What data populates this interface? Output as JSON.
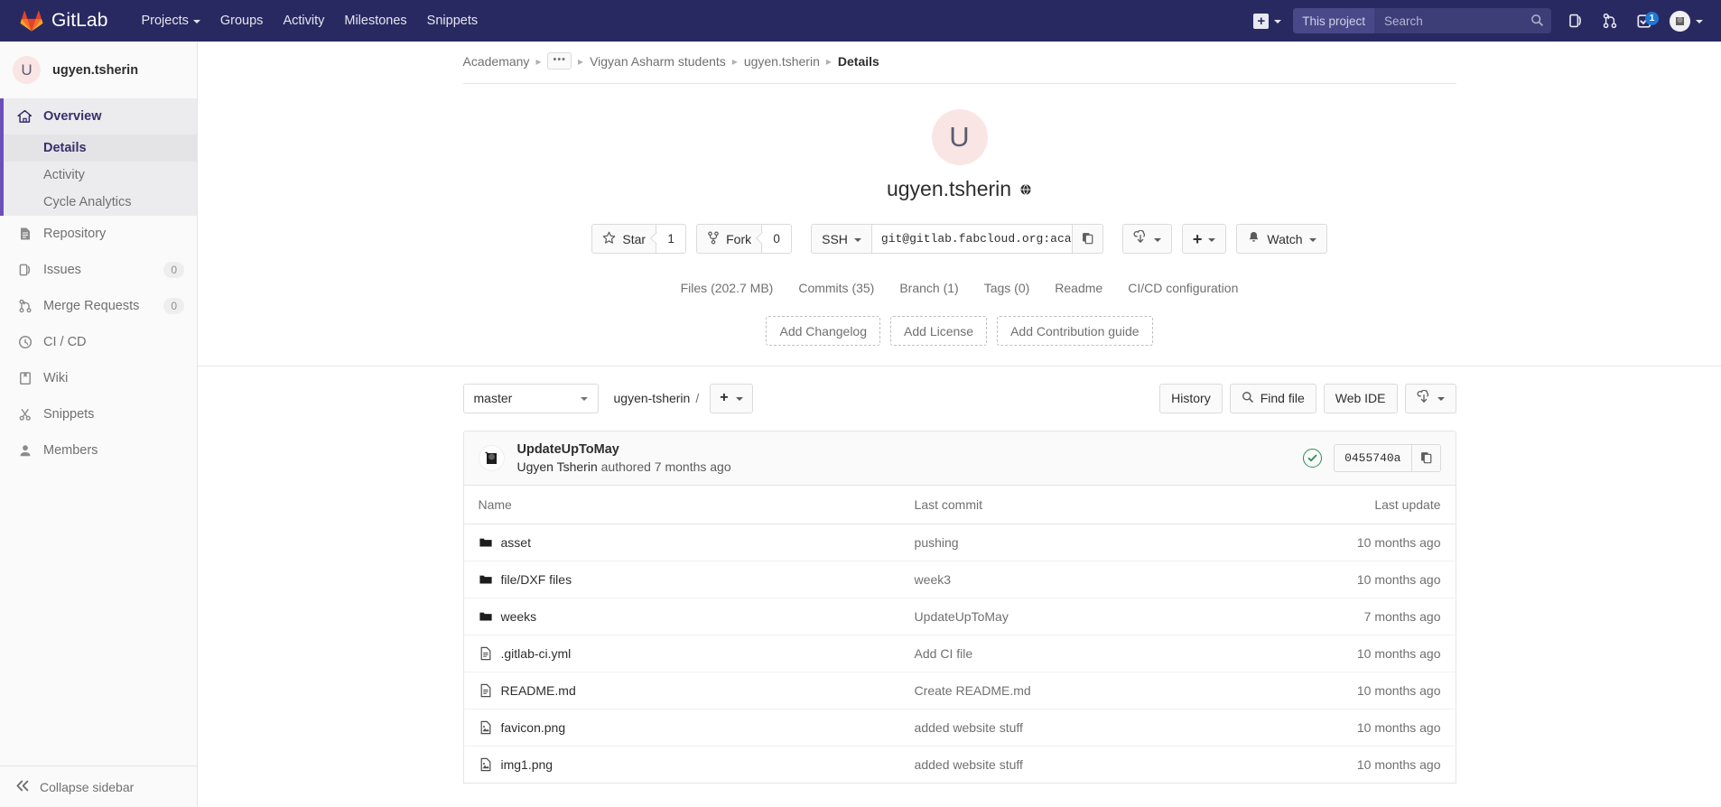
{
  "navbar": {
    "brand": "GitLab",
    "brand_icon": "gitlab-tanuki-logo",
    "links": [
      {
        "label": "Projects",
        "has_caret": true
      },
      {
        "label": "Groups",
        "has_caret": false
      },
      {
        "label": "Activity",
        "has_caret": false
      },
      {
        "label": "Milestones",
        "has_caret": false
      },
      {
        "label": "Snippets",
        "has_caret": false
      }
    ],
    "new_button": {
      "icon": "plus-square-icon",
      "label": "+",
      "caret": true
    },
    "search": {
      "scope_label": "This project",
      "placeholder": "Search",
      "value": "",
      "icon": "search-icon"
    },
    "icons": [
      {
        "name": "issues-icon",
        "title": "Issues"
      },
      {
        "name": "merge-requests-icon",
        "title": "Merge requests"
      },
      {
        "name": "todos-icon",
        "title": "Todos",
        "badge": "1"
      }
    ],
    "avatar": {
      "name": "user-avatar",
      "caret": true
    },
    "colors": {
      "bg": "#292961",
      "search_bg": "#3d3d78",
      "badge": "#1f78d1"
    }
  },
  "sidebar": {
    "project": {
      "initial": "U",
      "name": "ugyen.tsherin"
    },
    "groups": [
      {
        "label": "Overview",
        "icon": "home-icon",
        "active": true,
        "sub_items": [
          {
            "label": "Details",
            "current": true
          },
          {
            "label": "Activity",
            "current": false
          },
          {
            "label": "Cycle Analytics",
            "current": false
          }
        ]
      },
      {
        "label": "Repository",
        "icon": "doc-text-icon",
        "active": false,
        "sub_items": []
      },
      {
        "label": "Issues",
        "icon": "issues-icon",
        "count": "0",
        "active": false,
        "sub_items": []
      },
      {
        "label": "Merge Requests",
        "icon": "merge-requests-icon",
        "count": "0",
        "active": false,
        "sub_items": []
      },
      {
        "label": "CI / CD",
        "icon": "rocket-icon",
        "active": false,
        "sub_items": []
      },
      {
        "label": "Wiki",
        "icon": "book-icon",
        "active": false,
        "sub_items": []
      },
      {
        "label": "Snippets",
        "icon": "scissors-icon",
        "active": false,
        "sub_items": []
      },
      {
        "label": "Members",
        "icon": "users-icon",
        "active": false,
        "sub_items": []
      }
    ],
    "collapse": {
      "label": "Collapse sidebar",
      "icon": "chevron-double-left-icon"
    },
    "colors": {
      "bg": "#fafafa",
      "active_border": "#6b4fbb",
      "active_bg": "#ececef"
    }
  },
  "breadcrumb": {
    "items": [
      {
        "label": "Academany",
        "type": "link"
      },
      {
        "label": "•••",
        "type": "ellipsis"
      },
      {
        "label": "Vigyan Asharm students",
        "type": "link"
      },
      {
        "label": "ugyen.tsherin",
        "type": "link"
      },
      {
        "label": "Details",
        "type": "current"
      }
    ]
  },
  "project_home": {
    "avatar_initial": "U",
    "title": "ugyen.tsherin",
    "visibility_icon": "globe-public-icon",
    "actions": {
      "star": {
        "label": "Star",
        "icon": "star-icon",
        "count": "1"
      },
      "fork": {
        "label": "Fork",
        "icon": "fork-icon",
        "count": "0"
      },
      "clone": {
        "protocol": "SSH",
        "url": "git@gitlab.fabcloud.org:academany",
        "copy_icon": "copy-icon"
      },
      "download": {
        "icon": "download-cloud-icon",
        "caret": true
      },
      "add": {
        "icon": "plus-icon",
        "caret": true
      },
      "watch": {
        "label": "Watch",
        "icon": "bell-icon",
        "caret": true
      }
    },
    "stats": [
      "Files (202.7 MB)",
      "Commits (35)",
      "Branch (1)",
      "Tags (0)",
      "Readme",
      "CI/CD configuration"
    ],
    "suggestions": [
      "Add Changelog",
      "Add License",
      "Add Contribution guide"
    ]
  },
  "files": {
    "toolbar": {
      "branch": "master",
      "path_root": "ugyen-tsherin",
      "path_sep": "/",
      "add_button": {
        "icon": "plus-icon",
        "caret": true
      },
      "history_label": "History",
      "find_file_label": "Find file",
      "find_file_icon": "search-icon",
      "web_ide_label": "Web IDE",
      "download_icon": "download-cloud-icon"
    },
    "last_commit": {
      "title": "UpdateUpToMay",
      "author": "Ugyen Tsherin",
      "meta": "authored 7 months ago",
      "pipeline_status": "passed",
      "pipeline_icon": "check-circle-icon",
      "sha": "0455740a",
      "copy_icon": "copy-icon",
      "avatar_icon": "commit-author-avatar"
    },
    "columns": [
      "Name",
      "Last commit",
      "Last update"
    ],
    "rows": [
      {
        "icon": "folder-icon",
        "type": "folder",
        "name": "asset",
        "commit": "pushing",
        "update": "10 months ago"
      },
      {
        "icon": "folder-icon",
        "type": "folder",
        "name": "file/DXF files",
        "commit": "week3",
        "update": "10 months ago"
      },
      {
        "icon": "folder-icon",
        "type": "folder",
        "name": "weeks",
        "commit": "UpdateUpToMay",
        "update": "7 months ago"
      },
      {
        "icon": "file-text-icon",
        "type": "file",
        "name": ".gitlab-ci.yml",
        "commit": "Add CI file",
        "update": "10 months ago"
      },
      {
        "icon": "file-text-icon",
        "type": "file",
        "name": "README.md",
        "commit": "Create README.md",
        "update": "10 months ago"
      },
      {
        "icon": "file-image-icon",
        "type": "image",
        "name": "favicon.png",
        "commit": "added website stuff",
        "update": "10 months ago"
      },
      {
        "icon": "file-image-icon",
        "type": "image",
        "name": "img1.png",
        "commit": "added website stuff",
        "update": "10 months ago"
      }
    ]
  }
}
